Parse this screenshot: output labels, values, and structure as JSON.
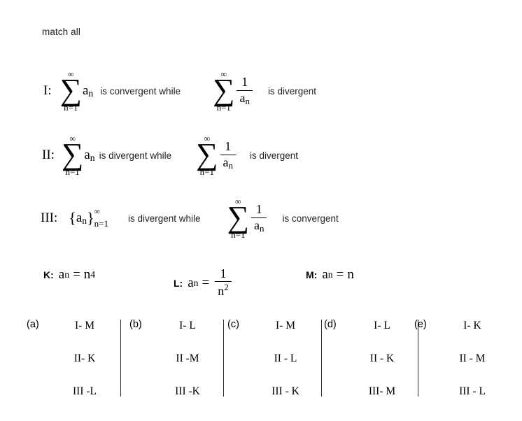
{
  "prompt": "match all",
  "statements": [
    {
      "label": "I:",
      "left_expr": {
        "sum_upper": "∞",
        "sum_symbol": "∑",
        "sum_lower": "n=1",
        "term": "a",
        "term_sub": "n"
      },
      "middle_text": "is convergent while",
      "right_expr": {
        "sum_upper": "∞",
        "sum_symbol": "∑",
        "sum_lower": "n=1",
        "numerator": "1",
        "denominator": "a",
        "denominator_sub": "n"
      },
      "trailing_text": "is divergent"
    },
    {
      "label": "II:",
      "left_expr": {
        "sum_upper": "∞",
        "sum_symbol": "∑",
        "sum_lower": "n=1",
        "term": "a",
        "term_sub": "n"
      },
      "middle_text": "is divergent while",
      "right_expr": {
        "sum_upper": "∞",
        "sum_symbol": "∑",
        "sum_lower": "n=1",
        "numerator": "1",
        "denominator": "a",
        "denominator_sub": "n"
      },
      "trailing_text": "is divergent"
    },
    {
      "label": "III:",
      "left_expr": {
        "open_brace": "{",
        "term": "a",
        "term_sub": "n",
        "close_brace": "}",
        "limit_upper": "∞",
        "limit_lower": "n=1"
      },
      "middle_text": "is divergent while",
      "right_expr": {
        "sum_upper": "∞",
        "sum_symbol": "∑",
        "sum_lower": "n=1",
        "numerator": "1",
        "denominator": "a",
        "denominator_sub": "n"
      },
      "trailing_text": "is convergent"
    }
  ],
  "definitions": [
    {
      "key": "K:",
      "var": "a",
      "var_sub": "n",
      "equals": "=",
      "value_base": "n",
      "value_exp": "4",
      "kind": "power"
    },
    {
      "key": "L:",
      "var": "a",
      "var_sub": "n",
      "equals": "=",
      "numerator": "1",
      "denominator_base": "n",
      "denominator_exp": "2",
      "kind": "fraction"
    },
    {
      "key": "M:",
      "var": "a",
      "var_sub": "n",
      "equals": "=",
      "value_base": "n",
      "kind": "plain"
    }
  ],
  "options": [
    {
      "tag": "(a)",
      "pairs": [
        "I- M",
        "II- K",
        "III -L"
      ]
    },
    {
      "tag": "(b)",
      "pairs": [
        "I- L",
        "II -M",
        "III -K"
      ]
    },
    {
      "tag": "(c)",
      "pairs": [
        "I- M",
        "II - L",
        "III - K"
      ]
    },
    {
      "tag": "(d)",
      "pairs": [
        "I- L",
        "II - K",
        "III- M"
      ]
    },
    {
      "tag": "(e)",
      "pairs": [
        "I- K",
        "II - M",
        "III - L"
      ]
    }
  ],
  "colors": {
    "background": "#ffffff",
    "text": "#1a1a1a",
    "math": "#000000",
    "divider": "#2b2b2b"
  }
}
